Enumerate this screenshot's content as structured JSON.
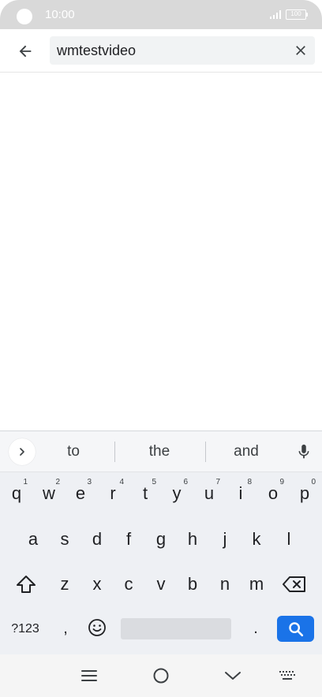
{
  "status_bar": {
    "time": "10:00",
    "battery": "100"
  },
  "search": {
    "value": "wmtestvideo"
  },
  "keyboard": {
    "suggestions": [
      "to",
      "the",
      "and"
    ],
    "row1": [
      {
        "key": "q",
        "hint": "1"
      },
      {
        "key": "w",
        "hint": "2"
      },
      {
        "key": "e",
        "hint": "3"
      },
      {
        "key": "r",
        "hint": "4"
      },
      {
        "key": "t",
        "hint": "5"
      },
      {
        "key": "y",
        "hint": "6"
      },
      {
        "key": "u",
        "hint": "7"
      },
      {
        "key": "i",
        "hint": "8"
      },
      {
        "key": "o",
        "hint": "9"
      },
      {
        "key": "p",
        "hint": "0"
      }
    ],
    "row2": [
      "a",
      "s",
      "d",
      "f",
      "g",
      "h",
      "j",
      "k",
      "l"
    ],
    "row3": [
      "z",
      "x",
      "c",
      "v",
      "b",
      "n",
      "m"
    ],
    "symbols_label": "?123",
    "comma": ",",
    "period": "."
  },
  "icons": {
    "back": "arrow-left-icon",
    "clear": "close-icon",
    "expand": "chevron-right-icon",
    "mic": "microphone-icon",
    "shift": "shift-icon",
    "backspace": "backspace-icon",
    "emoji": "emoji-icon",
    "search": "search-icon",
    "nav_menu": "menu-icon",
    "nav_home": "home-icon",
    "nav_back": "chevron-down-icon",
    "nav_keyboard": "keyboard-icon"
  },
  "colors": {
    "accent": "#1a73e8",
    "status_bar": "#d9d9d9",
    "keyboard_bg": "#eef0f4"
  }
}
